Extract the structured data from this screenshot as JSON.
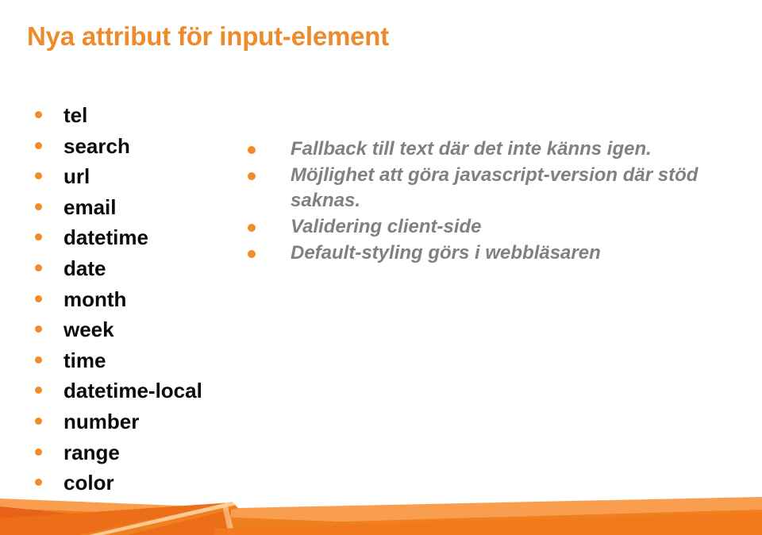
{
  "slide": {
    "title": "Nya attribut för input-element",
    "title_color": "#ED8B2C",
    "background_color": "#ffffff",
    "bullet_color": "#F28C28",
    "left_text_color": "#0a0a0a",
    "right_text_color": "#808080"
  },
  "left_column": {
    "items": [
      {
        "label": "tel"
      },
      {
        "label": "search"
      },
      {
        "label": "url"
      },
      {
        "label": "email"
      },
      {
        "label": "datetime"
      },
      {
        "label": "date"
      },
      {
        "label": "month"
      },
      {
        "label": "week"
      },
      {
        "label": "time"
      },
      {
        "label": "datetime-local"
      },
      {
        "label": "number"
      },
      {
        "label": "range"
      },
      {
        "label": "color"
      }
    ]
  },
  "right_column": {
    "items": [
      {
        "label": "Fallback till text där det inte känns igen."
      },
      {
        "label": "Möjlighet att göra javascript-version där stöd saknas."
      },
      {
        "label": "Validering client-side"
      },
      {
        "label": "Default-styling görs i webbläsaren"
      }
    ]
  },
  "decoration": {
    "ribbon_light": "#F5923E",
    "ribbon_mid": "#F07F20",
    "ribbon_dark": "#E8621A",
    "ribbon_accent": "#FAA85A",
    "ribbon_highlight": "#FBD9A8"
  }
}
